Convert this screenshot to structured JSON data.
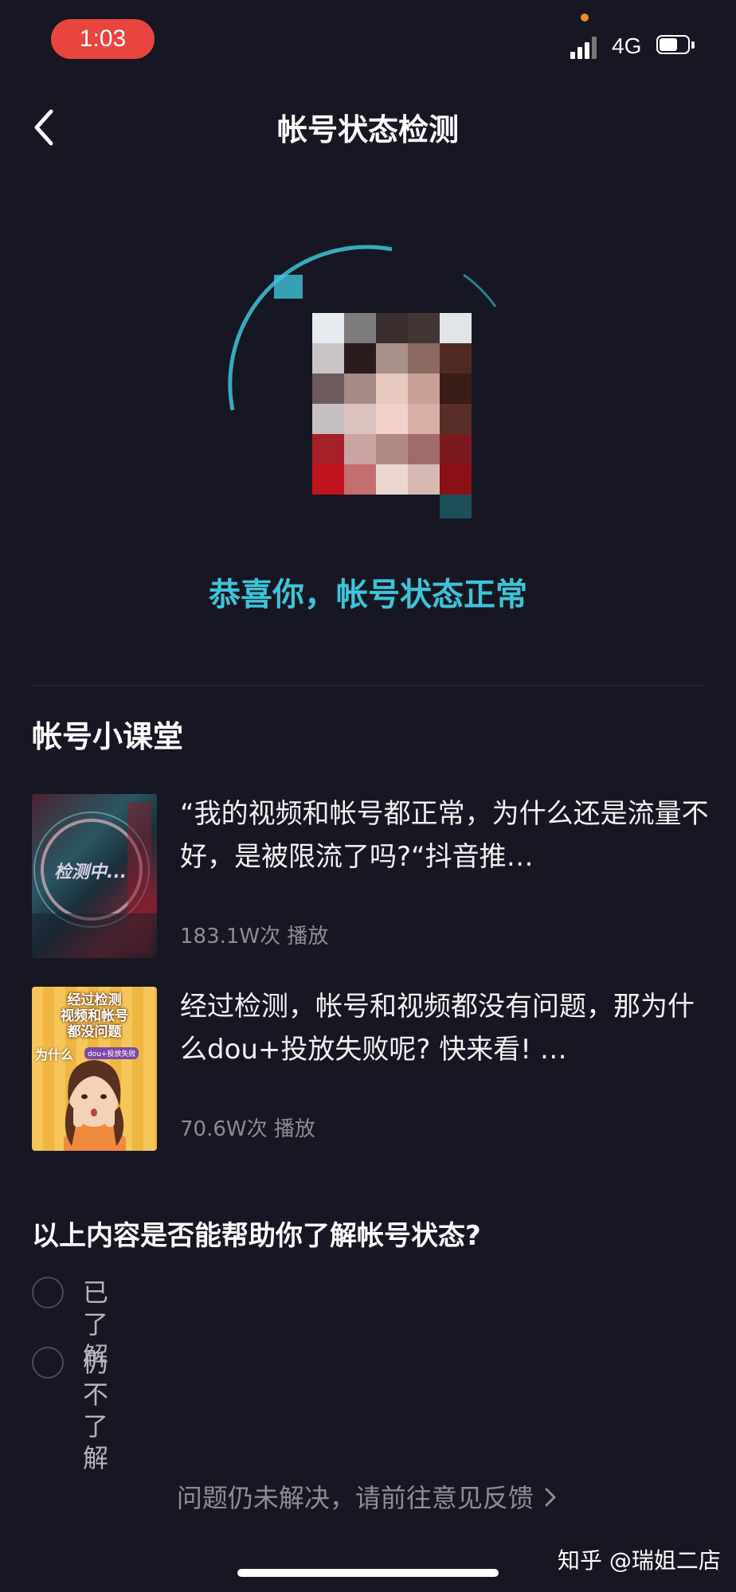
{
  "status_bar": {
    "time": "1:03",
    "network": "4G"
  },
  "header": {
    "title": "帐号状态检测"
  },
  "check": {
    "result": "恭喜你，帐号状态正常",
    "accent_color": "#3ec4d9"
  },
  "lessons": {
    "title": "帐号小课堂",
    "items": [
      {
        "title": "“我的视频和帐号都正常，为什么还是流量不好，是被限流了吗?“抖音推…",
        "stats": "183.1W次 播放",
        "thumb_text": "检测中..."
      },
      {
        "title": "经过检测，帐号和视频都没有问题，那为什么dou+投放失败呢? 快来看! …",
        "stats": "70.6W次 播放",
        "thumb_lines": [
          "经过检测",
          "视频和帐号",
          "都没问题"
        ],
        "thumb_caption": "为什么",
        "thumb_tag": "dou+投放失败"
      }
    ]
  },
  "survey": {
    "question": "以上内容是否能帮助你了解帐号状态?",
    "options": [
      "已了解",
      "仍不了解"
    ]
  },
  "footer": {
    "feedback": "问题仍未解决，请前往意见反馈",
    "watermark": "知乎 @瑞姐二店"
  }
}
